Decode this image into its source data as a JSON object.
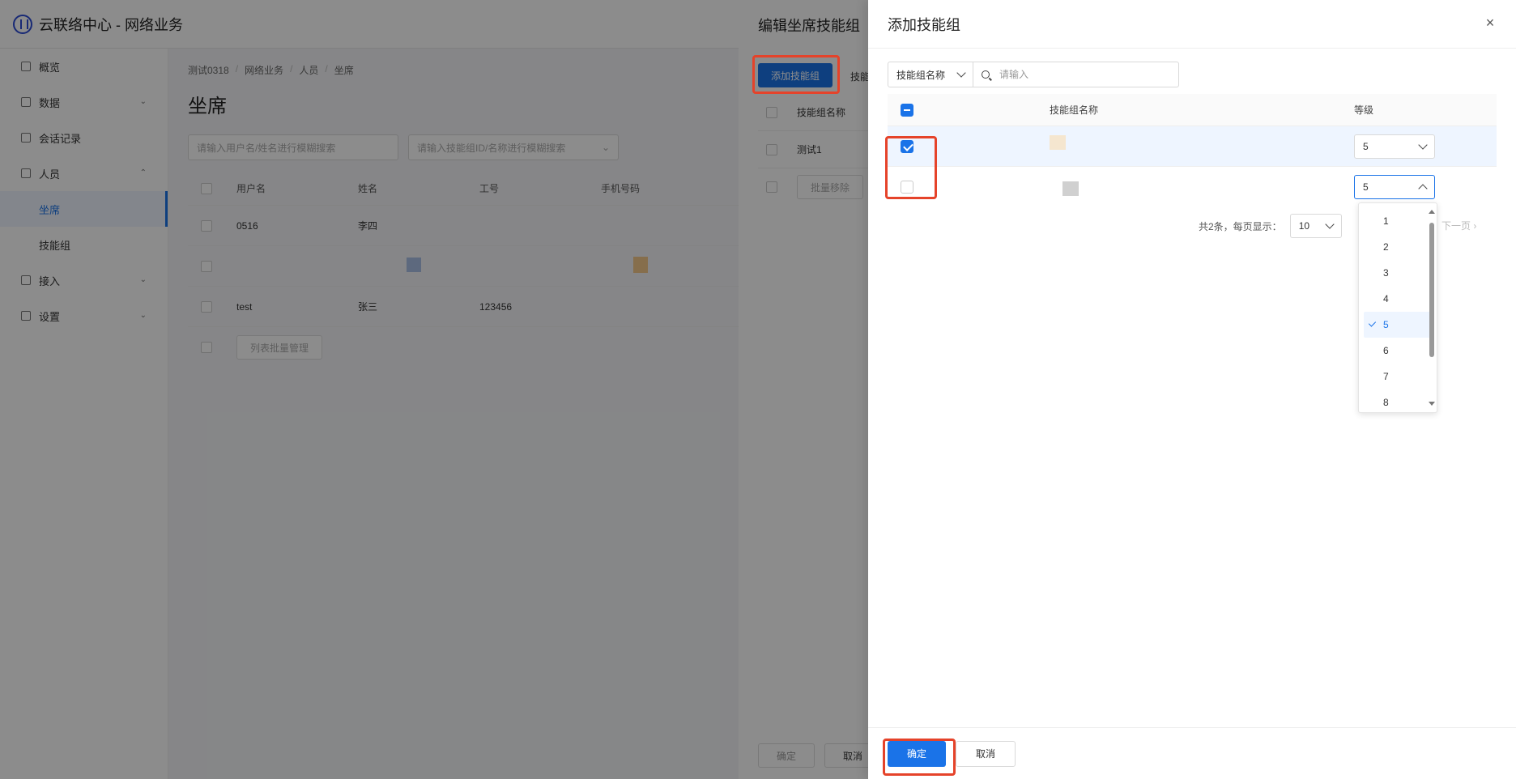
{
  "app": {
    "title": "云联络中心 - 网络业务"
  },
  "sidebar": {
    "items": [
      {
        "label": "概览"
      },
      {
        "label": "数据"
      },
      {
        "label": "会话记录"
      },
      {
        "label": "人员"
      },
      {
        "label": "坐席"
      },
      {
        "label": "技能组"
      },
      {
        "label": "接入"
      },
      {
        "label": "设置"
      }
    ]
  },
  "main": {
    "breadcrumb": [
      "测试0318",
      "网络业务",
      "人员",
      "坐席"
    ],
    "page_title": "坐席",
    "search_placeholder": "请输入用户名/姓名进行模糊搜索",
    "skill_filter_placeholder": "请输入技能组ID/名称进行模糊搜索",
    "columns": [
      "用户名",
      "姓名",
      "工号",
      "手机号码"
    ],
    "rows": [
      {
        "username": "0516",
        "name": "李四",
        "id": ""
      },
      {
        "username": "",
        "name": "",
        "id": ""
      },
      {
        "username": "test",
        "name": "张三",
        "id": "123456"
      }
    ],
    "batch_button": "列表批量管理"
  },
  "edit_drawer": {
    "title": "编辑坐席技能组",
    "add_button": "添加技能组",
    "tab_label": "技能",
    "column_name": "技能组名称",
    "row1": "测试1",
    "batch_remove": "批量移除",
    "confirm": "确定",
    "cancel": "取消"
  },
  "add_drawer": {
    "title": "添加技能组",
    "close": "×",
    "search_field": "技能组名称",
    "search_placeholder": "请输入",
    "columns": {
      "name": "技能组名称",
      "level": "等级"
    },
    "rows": [
      {
        "checked": true,
        "level": "5"
      },
      {
        "checked": false,
        "level": "5"
      }
    ],
    "pager": {
      "total_text": "共2条，每页显示：",
      "page_size": "10",
      "next": "下一页"
    },
    "level_options": [
      "1",
      "2",
      "3",
      "4",
      "5",
      "6",
      "7",
      "8"
    ],
    "level_selected": "5",
    "confirm": "确定",
    "cancel": "取消"
  },
  "colors": {
    "primary": "#1a73e8",
    "highlight": "#e5432a"
  }
}
